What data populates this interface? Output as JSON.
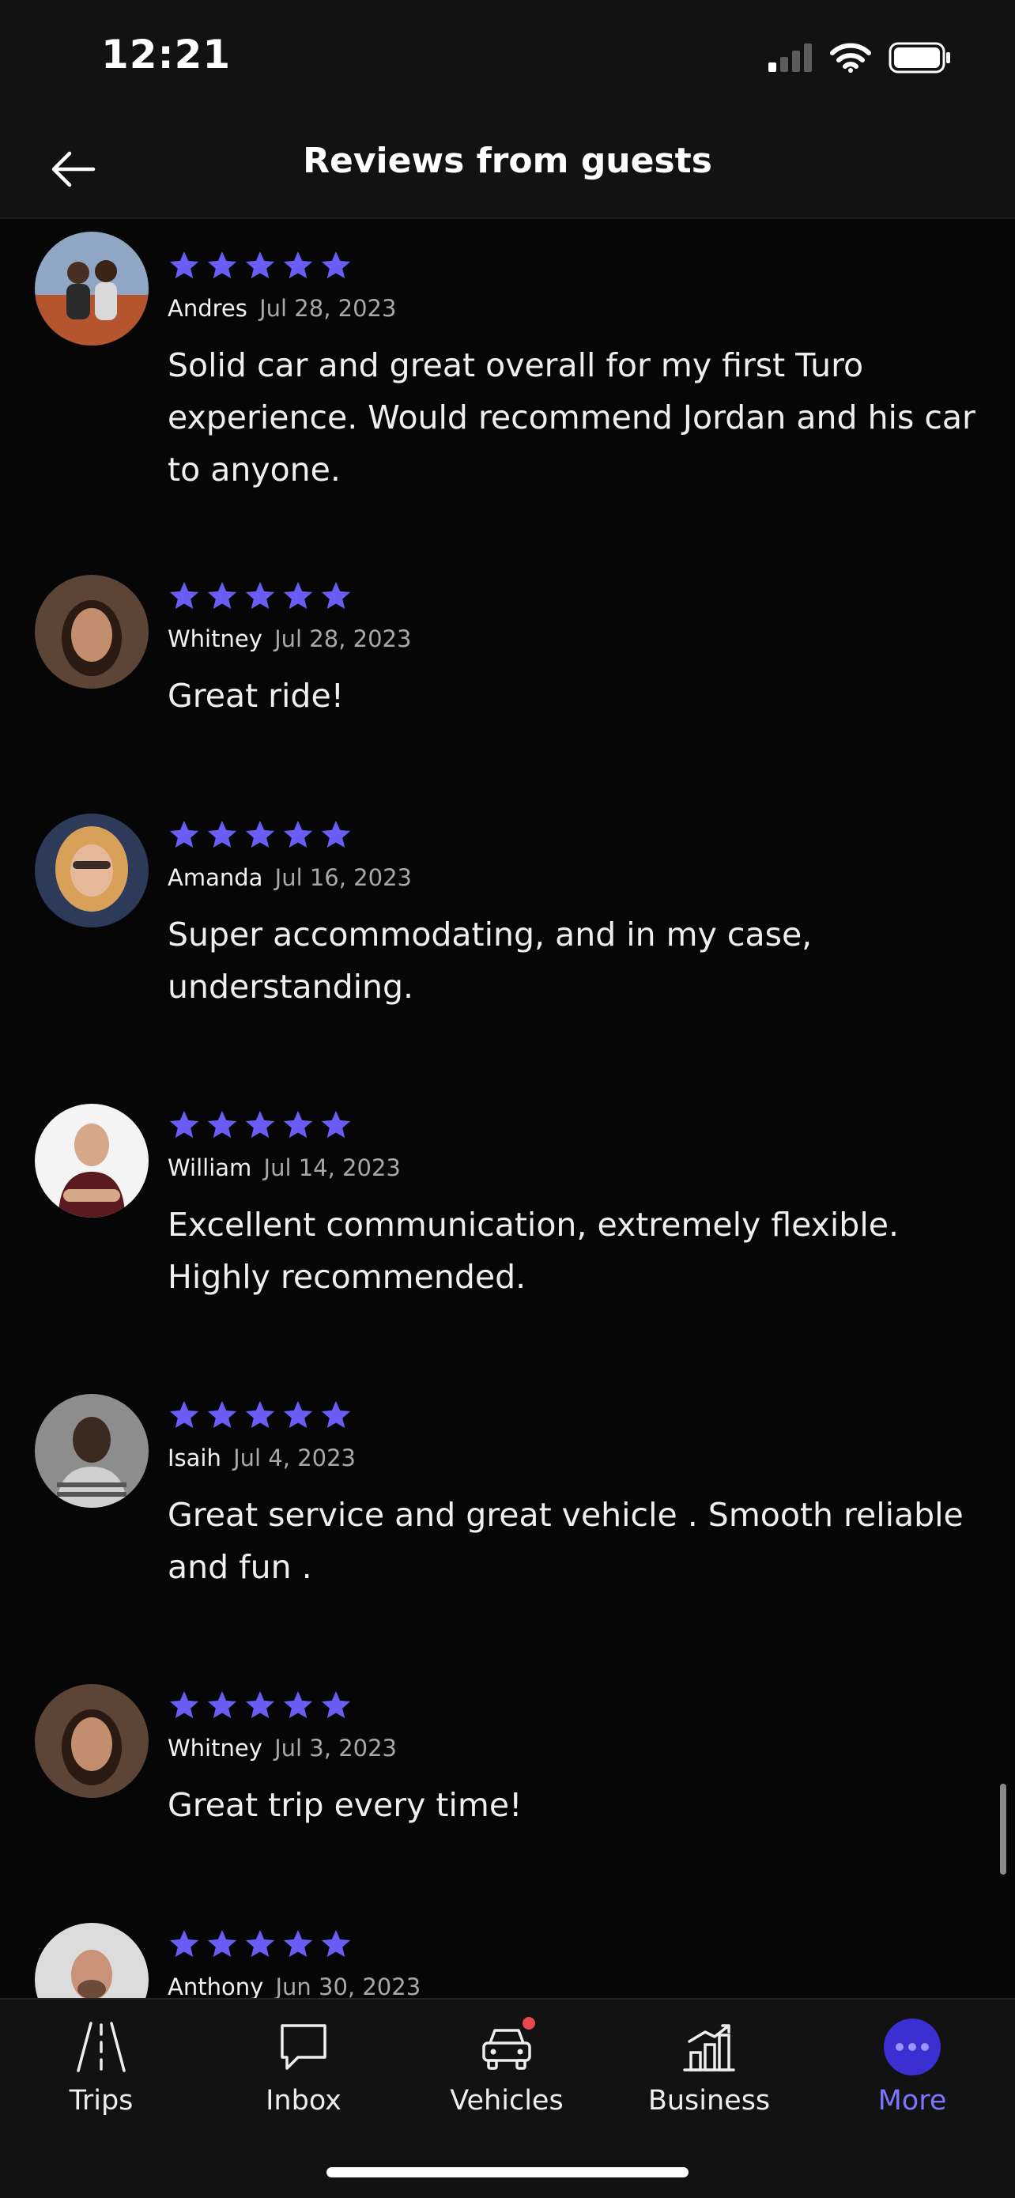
{
  "status": {
    "time": "12:21"
  },
  "header": {
    "title": "Reviews from guests"
  },
  "colors": {
    "accent": "#6a5df5",
    "background": "#060606",
    "bar": "#121212",
    "notification": "#e5484d"
  },
  "reviews": [
    {
      "name": "Andres",
      "date": "Jul 28, 2023",
      "rating": 5,
      "text": "Solid car and great overall for my first Turo experience. Would recommend Jordan and his car to anyone."
    },
    {
      "name": "Whitney",
      "date": "Jul 28, 2023",
      "rating": 5,
      "text": "Great ride!"
    },
    {
      "name": "Amanda",
      "date": "Jul 16, 2023",
      "rating": 5,
      "text": "Super accommodating, and in my case, understanding."
    },
    {
      "name": "William",
      "date": "Jul 14, 2023",
      "rating": 5,
      "text": "Excellent communication, extremely flexible. Highly recommended."
    },
    {
      "name": "Isaih",
      "date": "Jul 4, 2023",
      "rating": 5,
      "text": "Great service and great vehicle . Smooth reliable and fun ."
    },
    {
      "name": "Whitney",
      "date": "Jul 3, 2023",
      "rating": 5,
      "text": "Great trip every time!"
    },
    {
      "name": "Anthony",
      "date": "Jun 30, 2023",
      "rating": 5,
      "text": ""
    }
  ],
  "tabs": [
    {
      "label": "Trips",
      "icon": "road-icon"
    },
    {
      "label": "Inbox",
      "icon": "chat-bubble-icon"
    },
    {
      "label": "Vehicles",
      "icon": "car-icon"
    },
    {
      "label": "Business",
      "icon": "bar-chart-icon"
    },
    {
      "label": "More",
      "icon": "more-dots-icon"
    }
  ]
}
